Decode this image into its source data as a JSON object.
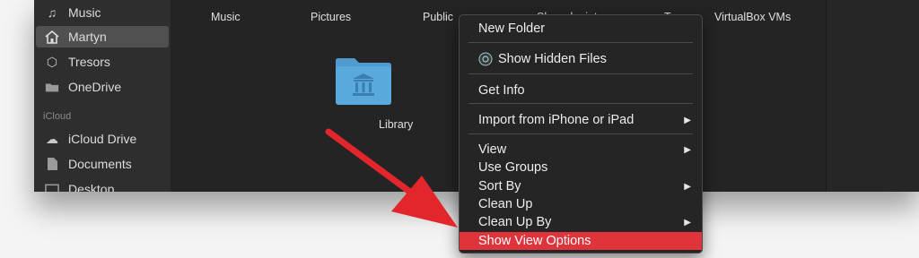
{
  "sidebar": {
    "items": [
      {
        "label": "Music",
        "icon": "music-note-icon"
      },
      {
        "label": "Martyn",
        "icon": "home-icon"
      },
      {
        "label": "Tresors",
        "icon": "tresor-icon"
      },
      {
        "label": "OneDrive",
        "icon": "folder-icon"
      },
      {
        "label": "iCloud Drive",
        "icon": "cloud-icon"
      },
      {
        "label": "Documents",
        "icon": "document-icon"
      },
      {
        "label": "Desktop",
        "icon": "desktop-icon"
      }
    ],
    "section_icloud": "iCloud"
  },
  "columns": [
    "Music",
    "Pictures",
    "Public",
    "Sharedpoint…",
    "T…",
    "VirtualBox VMs"
  ],
  "folder": {
    "label": "Library"
  },
  "context_menu": {
    "new_folder": "New Folder",
    "show_hidden": "Show Hidden Files",
    "get_info": "Get Info",
    "import": "Import from iPhone or iPad",
    "view": "View",
    "use_groups": "Use Groups",
    "sort_by": "Sort By",
    "clean_up": "Clean Up",
    "clean_up_by": "Clean Up By",
    "show_view_options": "Show View Options"
  },
  "colors": {
    "highlight": "#e0343c",
    "annotation_arrow": "#e3262b",
    "folder": "#5aa9dd"
  }
}
